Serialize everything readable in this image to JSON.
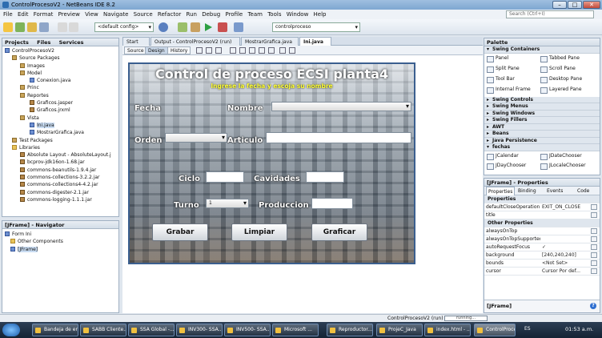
{
  "window": {
    "title": "ControlProcesoV2 - NetBeans IDE 8.2",
    "min": "–",
    "max": "□",
    "close": "✕"
  },
  "menu": [
    "File",
    "Edit",
    "Format",
    "Preview",
    "View",
    "Navigate",
    "Source",
    "Refactor",
    "Run",
    "Debug",
    "Profile",
    "Team",
    "Tools",
    "Window",
    "Help"
  ],
  "search": {
    "placeholder": "Search (Ctrl+I)"
  },
  "toolbar": {
    "config": "<default config>",
    "project": "controlproceso"
  },
  "projects": {
    "tabs": [
      "Projects",
      "Files",
      "Services"
    ],
    "tree": [
      "ControlProcesoV2",
      "Source Packages",
      "Images",
      "Model",
      "Conexion.java",
      "Princ",
      "Reportes",
      "Graficos.jasper",
      "Graficos.jrxml",
      "Vista",
      "Ini.java",
      "MostrarGrafica.java",
      "Test Packages",
      "Libraries",
      "Absolute Layout - AbsoluteLayout.j",
      "bcprov-jdk16on-1.68.jar",
      "commons-beanutils-1.9.4.jar",
      "commons-collections-3.2.2.jar",
      "commons-collections4-4.2.jar",
      "commons-digester-2.1.jar",
      "commons-logging-1.1.1.jar"
    ]
  },
  "navigator": {
    "title": "[JFrame] - Navigator",
    "tree": [
      "Form Ini",
      "Other Components",
      "[JFrame]"
    ]
  },
  "editor": {
    "tabs": [
      "Start Page",
      "Output - ControlProcesoV2 (run)",
      "MostrarGrafica.java",
      "Ini.java"
    ],
    "modes": [
      "Source",
      "Design",
      "History"
    ]
  },
  "form": {
    "title": "Control de proceso ECSI planta4",
    "subtitle": "Ingrese la fecha y escoja su nombre",
    "fecha": "Fecha",
    "nombre": "Nombre",
    "orden": "Orden",
    "articulo": "Articulo",
    "ciclo": "Ciclo",
    "cavidades": "Cavidades",
    "turno": "Turno",
    "turno_value": "1",
    "produccion": "Produccion",
    "grabar": "Grabar",
    "limpiar": "Limpiar",
    "graficar": "Graficar"
  },
  "palette": {
    "title": "Palette",
    "containers_header": "Swing Containers",
    "items": [
      "Panel",
      "Tabbed Pane",
      "Split Pane",
      "Scroll Pane",
      "Tool Bar",
      "Desktop Pane",
      "Internal Frame",
      "Layered Pane"
    ],
    "sections": [
      "Swing Controls",
      "Swing Menus",
      "Swing Windows",
      "Swing Fillers",
      "AWT",
      "Beans",
      "Java Persistence"
    ],
    "fechas_header": "fechas",
    "fechas": [
      "JCalendar",
      "JDateChooser",
      "JDayChooser",
      "JLocaleChooser"
    ]
  },
  "properties": {
    "title": "[JFrame] - Properties",
    "tabs": [
      "Properties",
      "Binding",
      "Events",
      "Code"
    ],
    "group1": "Properties",
    "group2": "Other Properties",
    "rows": [
      {
        "k": "defaultCloseOperation",
        "v": "EXIT_ON_CLOSE"
      },
      {
        "k": "title",
        "v": ""
      },
      {
        "k": "alwaysOnTop",
        "v": ""
      },
      {
        "k": "alwaysOnTopSupported",
        "v": ""
      },
      {
        "k": "autoRequestFocus",
        "v": "✓"
      },
      {
        "k": "background",
        "v": "[240,240,240]"
      },
      {
        "k": "bounds",
        "v": "<Not Set>"
      },
      {
        "k": "cursor",
        "v": "Cursor Por def..."
      }
    ],
    "footer": "[JFrame]"
  },
  "status": {
    "run": "ControlProcesoV2 (run)",
    "state": "running..."
  },
  "taskbar": {
    "items": [
      "Bandeja de ent...",
      "SABB Cliente...",
      "SSA Global -...",
      "INV300- SSA...",
      "INV500- SSA...",
      "Microsoft ...",
      "Reproductor...",
      "ProjeC_Java",
      "index.html - ...",
      "ControlProce..."
    ],
    "lang": "ES",
    "time": "01:53 a.m."
  }
}
